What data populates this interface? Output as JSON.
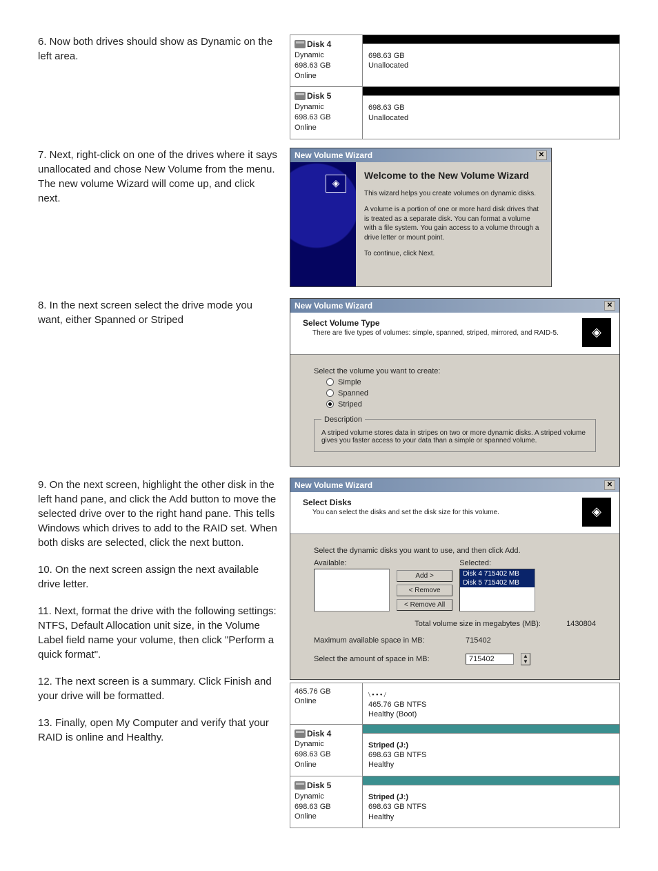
{
  "steps": {
    "s6": "6. Now both drives should show as Dynamic on the left area.",
    "s7": "7. Next, right-click on one of the drives where it says unallocated and chose New Volume from the menu. The new volume Wizard will come up, and click next.",
    "s8": "8. In the next screen select the drive mode you want, either Spanned or Striped",
    "s9": "9. On the next screen, highlight the other disk in the left hand pane, and click the Add button to move the selected drive over to the right hand pane. This tells Windows which drives to add to the RAID set. When both disks are selected, click the next button.",
    "s10": "10. On the next screen assign the next available drive letter.",
    "s11": "11. Next, format the drive with the following settings: NTFS, Default Allocation unit size, in the Volume Label field name your volume, then click \"Perform a quick format\".",
    "s12": "12. The next screen is a summary. Click Finish and your drive will be formatted.",
    "s13": "13. Finally, open My Computer and verify that your RAID is online and Healthy."
  },
  "disks_before": [
    {
      "name": "Disk 4",
      "type": "Dynamic",
      "size": "698.63 GB",
      "status": "Online",
      "part_size": "698.63 GB",
      "part_status": "Unallocated"
    },
    {
      "name": "Disk 5",
      "type": "Dynamic",
      "size": "698.63 GB",
      "status": "Online",
      "part_size": "698.63 GB",
      "part_status": "Unallocated"
    }
  ],
  "wiz_welcome": {
    "title": "New Volume Wizard",
    "heading": "Welcome to the New Volume Wizard",
    "p1": "This wizard helps you create volumes on dynamic disks.",
    "p2": "A volume is a portion of one or more hard disk drives that is treated as a separate disk. You can format a volume with a file system. You gain access to a volume through a drive letter or mount point.",
    "p3": "To continue, click Next."
  },
  "wiz_type": {
    "title": "New Volume Wizard",
    "header": "Select Volume Type",
    "sub": "There are five types of volumes: simple, spanned, striped, mirrored, and RAID-5.",
    "prompt": "Select the volume you want to create:",
    "opts": {
      "simple": "Simple",
      "spanned": "Spanned",
      "striped": "Striped"
    },
    "desc_legend": "Description",
    "desc": "A striped volume stores data in stripes on two or more dynamic disks. A striped volume gives you faster access to your data than a simple or spanned volume."
  },
  "wiz_sel": {
    "title": "New Volume Wizard",
    "header": "Select Disks",
    "sub": "You can select the disks and set the disk size for this volume.",
    "prompt": "Select the dynamic disks you want to use, and then click Add.",
    "available_lbl": "Available:",
    "selected_lbl": "Selected:",
    "selected_items": [
      "Disk 4    715402 MB",
      "Disk 5    715402 MB"
    ],
    "btns": {
      "add": "Add >",
      "remove": "< Remove",
      "removeall": "< Remove All"
    },
    "total_lbl": "Total volume size in megabytes (MB):",
    "total_val": "1430804",
    "max_lbl": "Maximum available space in MB:",
    "max_val": "715402",
    "amount_lbl": "Select the amount of space in MB:",
    "amount_val": "715402"
  },
  "disks_after_top": {
    "size": "465.76 GB",
    "status": "Online",
    "part_line1": "465.76 GB NTFS",
    "part_line2": "Healthy (Boot)"
  },
  "disks_after": [
    {
      "name": "Disk 4",
      "type": "Dynamic",
      "size": "698.63 GB",
      "status": "Online",
      "vol_name": "Striped (J:)",
      "vol_line2": "698.63 GB NTFS",
      "vol_line3": "Healthy"
    },
    {
      "name": "Disk 5",
      "type": "Dynamic",
      "size": "698.63 GB",
      "status": "Online",
      "vol_name": "Striped (J:)",
      "vol_line2": "698.63 GB NTFS",
      "vol_line3": "Healthy"
    }
  ]
}
